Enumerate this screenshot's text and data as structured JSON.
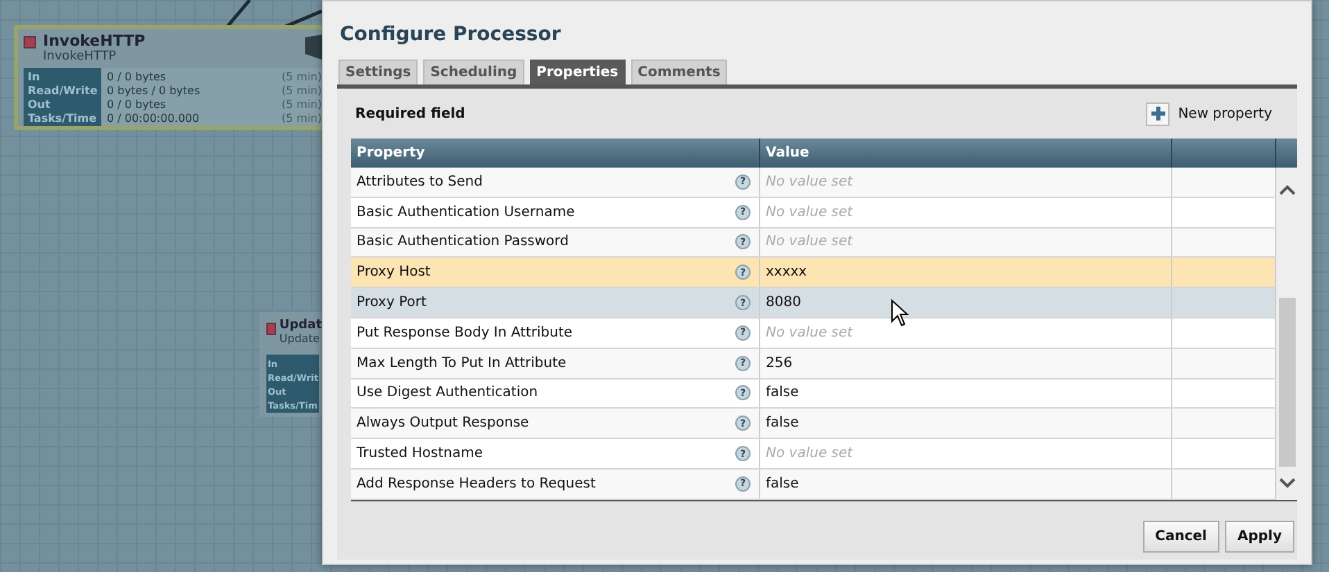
{
  "canvas": {
    "processors": [
      {
        "name": "InvokeHTTP",
        "type": "InvokeHTTP",
        "selected": true,
        "stats": [
          {
            "label": "In",
            "value": "0 / 0 bytes",
            "period": "(5 min)"
          },
          {
            "label": "Read/Write",
            "value": "0 bytes / 0 bytes",
            "period": "(5 min)"
          },
          {
            "label": "Out",
            "value": "0 / 0 bytes",
            "period": "(5 min)"
          },
          {
            "label": "Tasks/Time",
            "value": "0 / 00:00:00.000",
            "period": "(5 min)"
          }
        ]
      },
      {
        "name": "Updat",
        "type": "Update",
        "selected": false,
        "stats": [
          {
            "label": "In"
          },
          {
            "label": "Read/Writ"
          },
          {
            "label": "Out"
          },
          {
            "label": "Tasks/Tim"
          }
        ]
      }
    ]
  },
  "dialog": {
    "title": "Configure Processor",
    "tabs": [
      {
        "label": "Settings",
        "selected": false
      },
      {
        "label": "Scheduling",
        "selected": false
      },
      {
        "label": "Properties",
        "selected": true
      },
      {
        "label": "Comments",
        "selected": false
      }
    ],
    "required_field": "Required field",
    "new_property": "New property",
    "table": {
      "columns": [
        "Property",
        "Value"
      ],
      "rows": [
        {
          "property": "Attributes to Send",
          "help": "?",
          "value": "No value set",
          "set": false,
          "selected": false,
          "hovered": false
        },
        {
          "property": "Basic Authentication Username",
          "help": "?",
          "value": "No value set",
          "set": false,
          "selected": false,
          "hovered": false
        },
        {
          "property": "Basic Authentication Password",
          "help": "?",
          "value": "No value set",
          "set": false,
          "selected": false,
          "hovered": false
        },
        {
          "property": "Proxy Host",
          "help": "?",
          "value": "xxxxx",
          "set": true,
          "selected": true,
          "hovered": false
        },
        {
          "property": "Proxy Port",
          "help": "?",
          "value": "8080",
          "set": true,
          "selected": false,
          "hovered": true
        },
        {
          "property": "Put Response Body In Attribute",
          "help": "?",
          "value": "No value set",
          "set": false,
          "selected": false,
          "hovered": false
        },
        {
          "property": "Max Length To Put In Attribute",
          "help": "?",
          "value": "256",
          "set": true,
          "selected": false,
          "hovered": false
        },
        {
          "property": "Use Digest Authentication",
          "help": "?",
          "value": "false",
          "set": true,
          "selected": false,
          "hovered": false
        },
        {
          "property": "Always Output Response",
          "help": "?",
          "value": "false",
          "set": true,
          "selected": false,
          "hovered": false
        },
        {
          "property": "Trusted Hostname",
          "help": "?",
          "value": "No value set",
          "set": false,
          "selected": false,
          "hovered": false
        },
        {
          "property": "Add Response Headers to Request",
          "help": "?",
          "value": "false",
          "set": true,
          "selected": false,
          "hovered": false
        }
      ]
    },
    "buttons": [
      "Cancel",
      "Apply"
    ]
  }
}
